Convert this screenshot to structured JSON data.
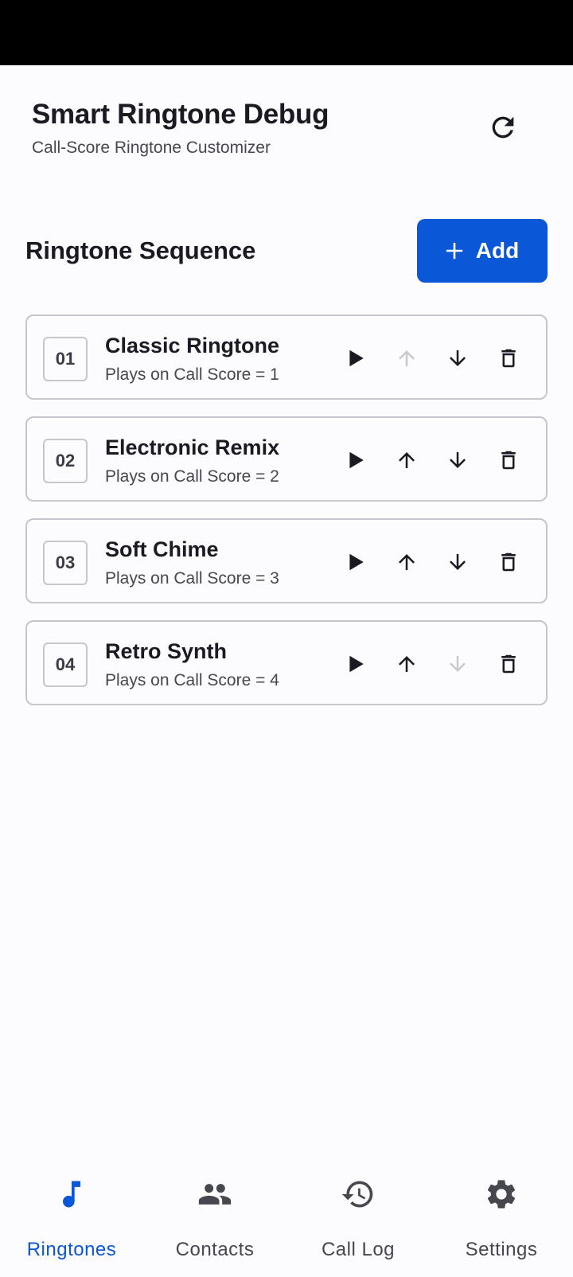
{
  "header": {
    "title": "Smart Ringtone Debug",
    "subtitle": "Call-Score Ringtone Customizer",
    "refresh_icon": "refresh-icon"
  },
  "section": {
    "title": "Ringtone Sequence",
    "add_label": "Add"
  },
  "ringtones": [
    {
      "num": "01",
      "name": "Classic Ringtone",
      "desc": "Plays on Call Score = 1",
      "up_enabled": false,
      "down_enabled": true
    },
    {
      "num": "02",
      "name": "Electronic Remix",
      "desc": "Plays on Call Score = 2",
      "up_enabled": true,
      "down_enabled": true
    },
    {
      "num": "03",
      "name": "Soft Chime",
      "desc": "Plays on Call Score = 3",
      "up_enabled": true,
      "down_enabled": true
    },
    {
      "num": "04",
      "name": "Retro Synth",
      "desc": "Plays on Call Score = 4",
      "up_enabled": true,
      "down_enabled": false
    }
  ],
  "nav": {
    "items": [
      {
        "label": "Ringtones",
        "icon": "music-note-icon",
        "active": true
      },
      {
        "label": "Contacts",
        "icon": "people-icon",
        "active": false
      },
      {
        "label": "Call Log",
        "icon": "history-icon",
        "active": false
      },
      {
        "label": "Settings",
        "icon": "gear-icon",
        "active": false
      }
    ]
  },
  "colors": {
    "accent": "#0a57d8",
    "icon": "#1a1b22",
    "icon_disabled": "#c9c9cf",
    "nav_icon": "#46474f"
  }
}
